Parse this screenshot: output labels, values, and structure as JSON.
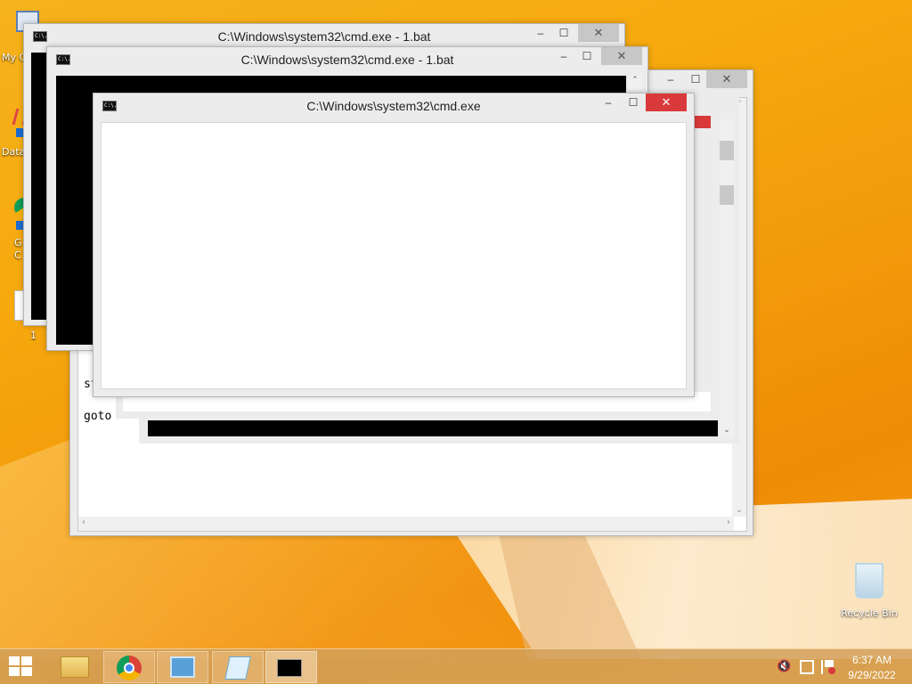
{
  "desktop": {
    "icons": [
      {
        "label": "My C"
      },
      {
        "label": "Data"
      },
      {
        "label": "G\nC"
      },
      {
        "label": "1"
      },
      {
        "label": "Recycle Bin"
      }
    ]
  },
  "windows": {
    "cmd1": {
      "title": "C:\\Windows\\system32\\cmd.exe - 1.bat"
    },
    "cmd2": {
      "title": "C:\\Windows\\system32\\cmd.exe - 1.bat"
    },
    "cmd_front": {
      "title": "C:\\Windows\\system32\\cmd.exe"
    },
    "notepad": {
      "line1": "st",
      "line2": "goto"
    }
  },
  "caption": {
    "minimize": "–",
    "maximize": "☐",
    "close": "✕"
  },
  "taskbar": {
    "time": "6:37 AM",
    "date": "9/29/2022"
  }
}
